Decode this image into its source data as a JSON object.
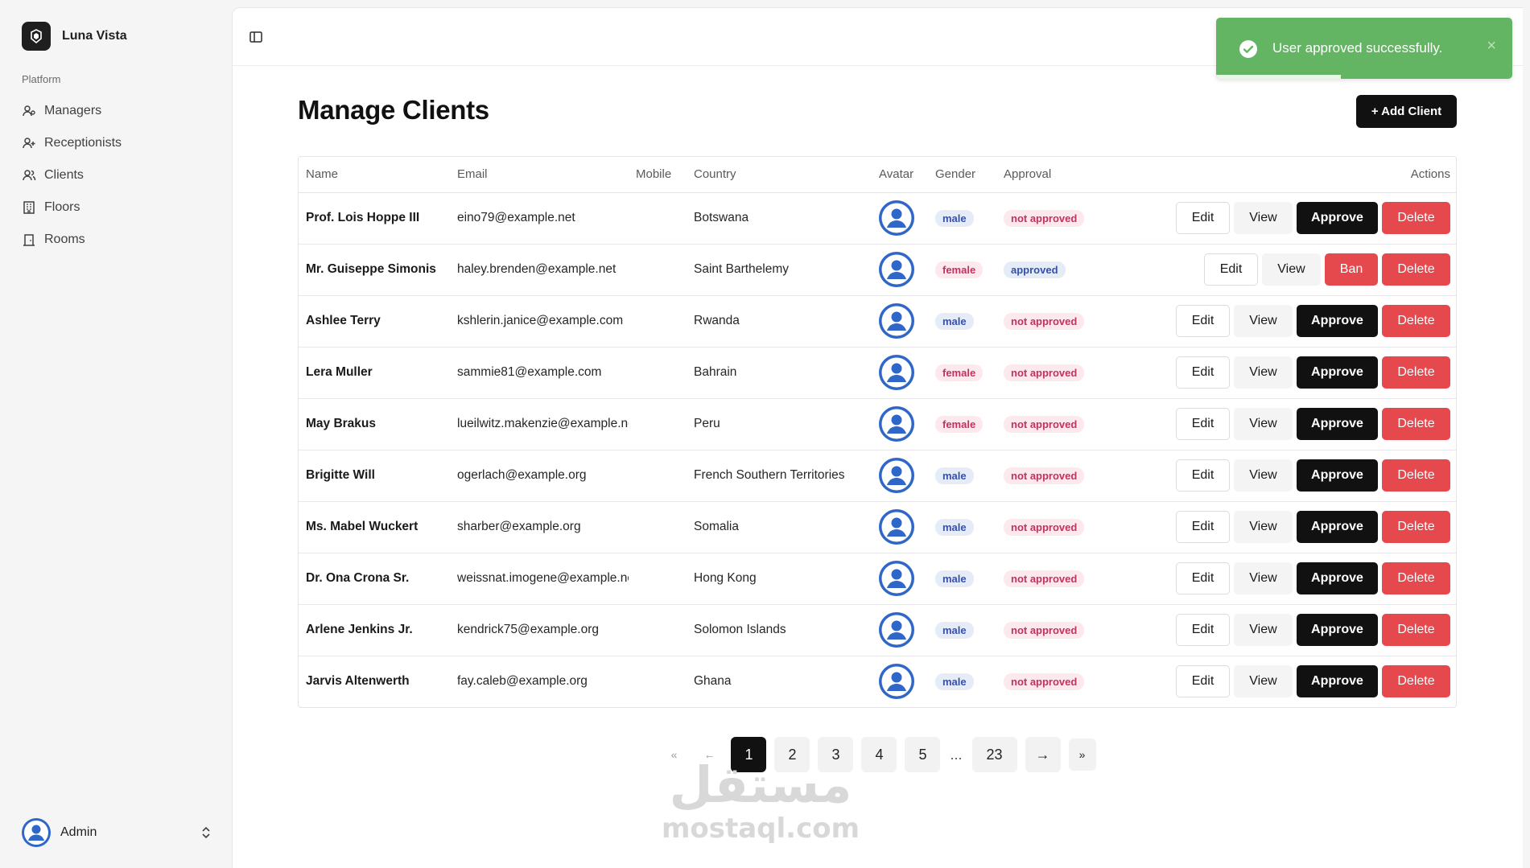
{
  "app": {
    "name": "Luna Vista"
  },
  "sidebar": {
    "group_label": "Platform",
    "items": [
      {
        "label": "Managers",
        "icon": "user-icon"
      },
      {
        "label": "Receptionists",
        "icon": "user-plus-icon"
      },
      {
        "label": "Clients",
        "icon": "users-icon"
      },
      {
        "label": "Floors",
        "icon": "building-icon"
      },
      {
        "label": "Rooms",
        "icon": "door-icon"
      }
    ],
    "user": {
      "name": "Admin"
    }
  },
  "page": {
    "title": "Manage Clients",
    "add_button": "+ Add Client"
  },
  "table": {
    "headers": {
      "name": "Name",
      "email": "Email",
      "mobile": "Mobile",
      "country": "Country",
      "avatar": "Avatar",
      "gender": "Gender",
      "approval": "Approval",
      "actions": "Actions"
    },
    "buttons": {
      "edit": "Edit",
      "view": "View",
      "approve": "Approve",
      "ban": "Ban",
      "delete": "Delete"
    },
    "rows": [
      {
        "name": "Prof. Lois Hoppe III",
        "email": "eino79@example.net",
        "mobile": "",
        "country": "Botswana",
        "gender": "male",
        "approval": "not approved"
      },
      {
        "name": "Mr. Guiseppe Simonis",
        "email": "haley.brenden@example.net",
        "mobile": "",
        "country": "Saint Barthelemy",
        "gender": "female",
        "approval": "approved"
      },
      {
        "name": "Ashlee Terry",
        "email": "kshlerin.janice@example.com",
        "mobile": "",
        "country": "Rwanda",
        "gender": "male",
        "approval": "not approved"
      },
      {
        "name": "Lera Muller",
        "email": "sammie81@example.com",
        "mobile": "",
        "country": "Bahrain",
        "gender": "female",
        "approval": "not approved"
      },
      {
        "name": "May Brakus",
        "email": "lueilwitz.makenzie@example.net",
        "mobile": "",
        "country": "Peru",
        "gender": "female",
        "approval": "not approved"
      },
      {
        "name": "Brigitte Will",
        "email": "ogerlach@example.org",
        "mobile": "",
        "country": "French Southern Territories",
        "gender": "male",
        "approval": "not approved"
      },
      {
        "name": "Ms. Mabel Wuckert",
        "email": "sharber@example.org",
        "mobile": "",
        "country": "Somalia",
        "gender": "male",
        "approval": "not approved"
      },
      {
        "name": "Dr. Ona Crona Sr.",
        "email": "weissnat.imogene@example.net",
        "mobile": "",
        "country": "Hong Kong",
        "gender": "male",
        "approval": "not approved"
      },
      {
        "name": "Arlene Jenkins Jr.",
        "email": "kendrick75@example.org",
        "mobile": "",
        "country": "Solomon Islands",
        "gender": "male",
        "approval": "not approved"
      },
      {
        "name": "Jarvis Altenwerth",
        "email": "fay.caleb@example.org",
        "mobile": "",
        "country": "Ghana",
        "gender": "male",
        "approval": "not approved"
      }
    ]
  },
  "pagination": {
    "first": "«",
    "prev": "←",
    "pages": [
      "1",
      "2",
      "3",
      "4",
      "5"
    ],
    "ellipsis": "...",
    "last_page": "23",
    "current": "1",
    "next": "→",
    "last": "»"
  },
  "toast": {
    "message": "User approved successfully.",
    "close": "×",
    "progress": 0.42,
    "color": "#63b563"
  },
  "watermark": {
    "arabic": "مستقل",
    "latin": "mostaql.com"
  },
  "colors": {
    "accent": "#111111",
    "danger": "#e5484d",
    "success": "#63b563"
  }
}
